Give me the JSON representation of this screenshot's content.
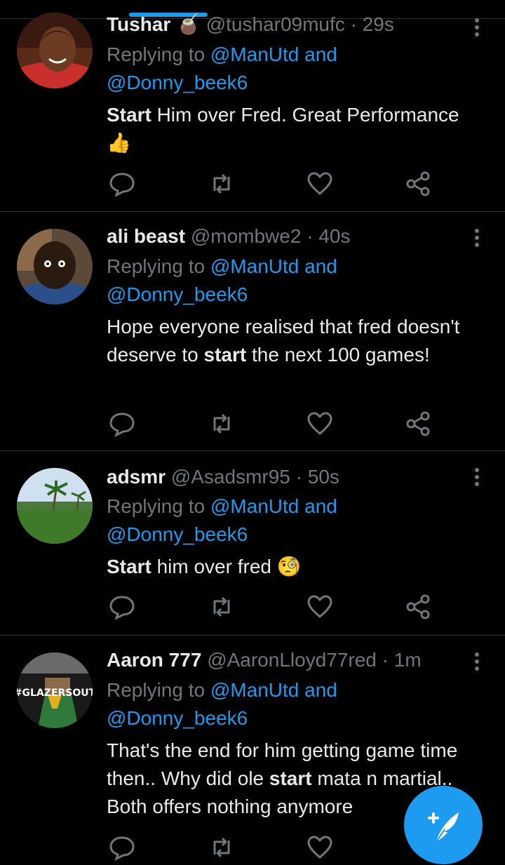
{
  "tweets": [
    {
      "name": "Tushar",
      "emoji": "🧉",
      "handle": "@tushar09mufc",
      "time": "· 29s",
      "reply_prefix": "Replying to",
      "reply_line1": "@ManUtd and",
      "reply_line2": "@Donny_beek6",
      "text_bold": "Start",
      "text_rest": " Him over Fred. Great Performance",
      "text_emoji": "👍"
    },
    {
      "name": "ali beast",
      "handle": "@mombwe2",
      "time": "· 40s",
      "reply_prefix": "Replying to",
      "reply_line1": "@ManUtd and",
      "reply_line2": "@Donny_beek6",
      "text_pre": "Hope everyone realised that fred doesn't deserve to ",
      "text_bold": "start",
      "text_post": " the next 100 games!"
    },
    {
      "name": "adsmr",
      "handle": "@Asadsmr95",
      "time": "· 50s",
      "reply_prefix": "Replying to",
      "reply_line1": "@ManUtd and",
      "reply_line2": "@Donny_beek6",
      "text_bold": "Start",
      "text_rest": " him over fred",
      "text_emoji": "🧐"
    },
    {
      "name": "Aaron 777",
      "handle": "@AaronLloyd77red",
      "time": "· 1m",
      "avatar_text": "#GLAZERSOUT",
      "reply_prefix": "Replying to",
      "reply_line1": "@ManUtd and",
      "reply_line2": "@Donny_beek6",
      "text_pre": "That's the end for him getting game time then.. Why did ole ",
      "text_bold": "start",
      "text_post": " mata n martial.. Both offers nothing anymore"
    }
  ],
  "icons": {
    "reply": "reply-icon",
    "retweet": "retweet-icon",
    "like": "like-icon",
    "share": "share-icon",
    "more": "more-vertical-icon",
    "compose": "compose-tweet-icon"
  },
  "colors": {
    "background": "#000000",
    "accent": "#1d9bf0",
    "muted": "#71767b",
    "text": "#e7e9ea"
  }
}
